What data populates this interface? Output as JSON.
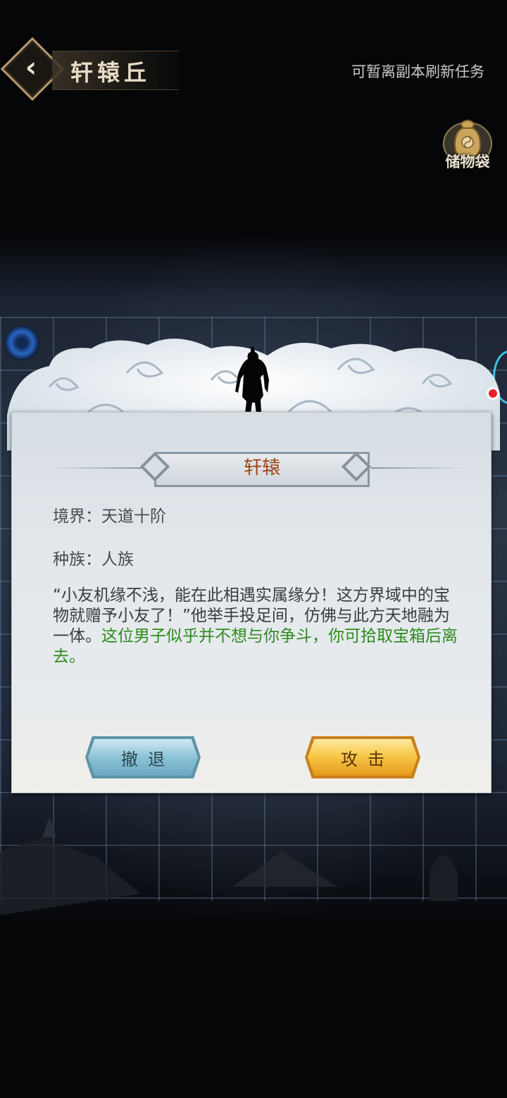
{
  "header": {
    "back_icon": "chevron-left-icon",
    "location_title": "轩辕丘",
    "hint_text": "可暂离副本刷新任务",
    "storage_label": "储物袋",
    "storage_icon": "bag-icon"
  },
  "dialog": {
    "npc_name": "轩辕",
    "realm_label": "境界：",
    "realm_value": "天道十阶",
    "race_label": "种族：",
    "race_value": "人族",
    "description_normal": "“小友机缘不浅，能在此相遇实属缘分！这方界域中的宝物就赠予小友了！”他举手投足间，仿佛与此方天地融为一体。",
    "description_highlight": "这位男子似乎并不想与你争斗，你可拾取宝箱后离去。",
    "retreat_label": "撤退",
    "attack_label": "攻击"
  },
  "colors": {
    "npc_name": "#a1461a",
    "highlight_text": "#2e8b1f",
    "retreat_button": "#8cc3d6",
    "attack_button": "#f7c94a"
  }
}
